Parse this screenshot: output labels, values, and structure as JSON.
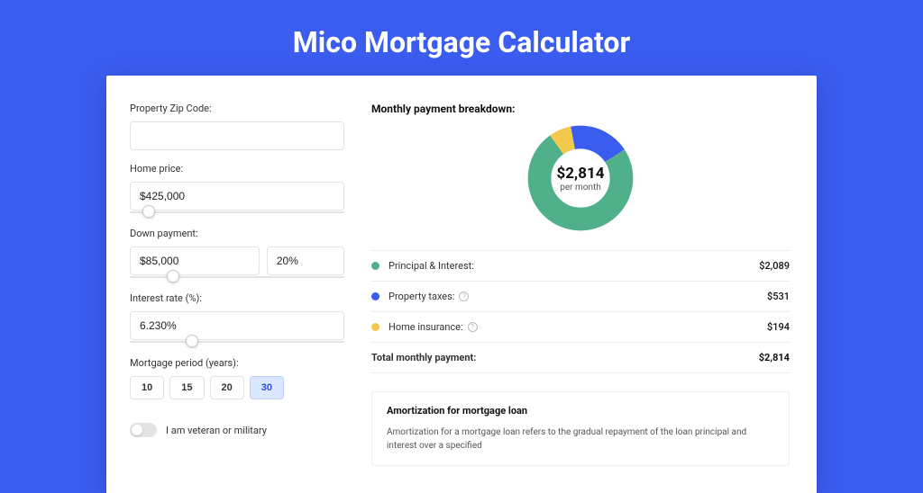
{
  "title": "Mico Mortgage Calculator",
  "form": {
    "zip_label": "Property Zip Code:",
    "zip_value": "",
    "home_price_label": "Home price:",
    "home_price_value": "$425,000",
    "home_price_slider_pct": 9,
    "down_payment_label": "Down payment:",
    "down_payment_value": "$85,000",
    "down_payment_pct": "20%",
    "down_payment_slider_pct": 20,
    "interest_label": "Interest rate (%):",
    "interest_value": "6.230%",
    "interest_slider_pct": 29,
    "period_label": "Mortgage period (years):",
    "periods": [
      "10",
      "15",
      "20",
      "30"
    ],
    "period_selected": "30",
    "veteran_label": "I am veteran or military"
  },
  "breakdown": {
    "heading": "Monthly payment breakdown:",
    "center_amount": "$2,814",
    "center_sub": "per month",
    "items": [
      {
        "label": "Principal & Interest:",
        "value": "$2,089",
        "color": "#4fb08a",
        "help": false
      },
      {
        "label": "Property taxes:",
        "value": "$531",
        "color": "#3a5cef",
        "help": true
      },
      {
        "label": "Home insurance:",
        "value": "$194",
        "color": "#f2c94c",
        "help": true
      }
    ],
    "total_label": "Total monthly payment:",
    "total_value": "$2,814"
  },
  "chart_data": {
    "type": "pie",
    "title": "Monthly payment breakdown",
    "series": [
      {
        "name": "Principal & Interest",
        "value": 2089,
        "color": "#4fb08a"
      },
      {
        "name": "Property taxes",
        "value": 531,
        "color": "#3a5cef"
      },
      {
        "name": "Home insurance",
        "value": 194,
        "color": "#f2c94c"
      }
    ],
    "total": 2814
  },
  "amortization": {
    "title": "Amortization for mortgage loan",
    "text": "Amortization for a mortgage loan refers to the gradual repayment of the loan principal and interest over a specified"
  }
}
